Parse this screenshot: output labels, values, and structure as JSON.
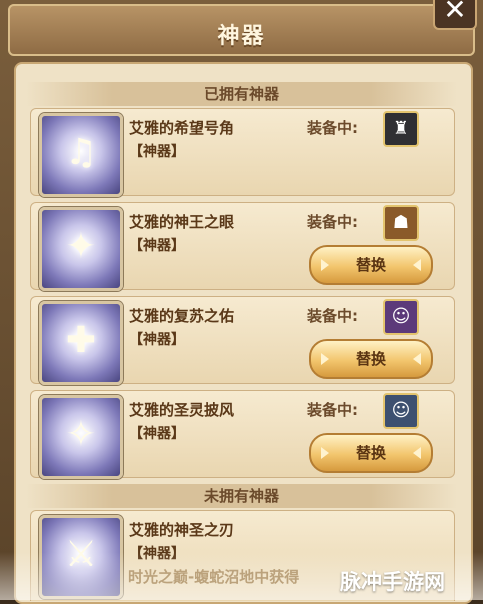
{
  "window": {
    "title": "神器",
    "close_label": "✕"
  },
  "sections": {
    "owned": "已拥有神器",
    "unowned": "未拥有神器"
  },
  "owned_items": [
    {
      "name": "艾雅的希望号角",
      "tag": "【神器】",
      "equip_label": "装备中:",
      "icon": "horn-icon",
      "avatar": "hero-armored-knight-avatar",
      "swap_label": ""
    },
    {
      "name": "艾雅的神王之眼",
      "tag": "【神器】",
      "equip_label": "装备中:",
      "icon": "eye-icon",
      "avatar": "hero-warrior-avatar",
      "swap_label": "替换"
    },
    {
      "name": "艾雅的复苏之佑",
      "tag": "【神器】",
      "equip_label": "装备中:",
      "icon": "winged-cross-icon",
      "avatar": "hero-red-haired-girl-avatar",
      "swap_label": "替换"
    },
    {
      "name": "艾雅的圣灵披风",
      "tag": "【神器】",
      "equip_label": "装备中:",
      "icon": "cloak-icon",
      "avatar": "hero-blonde-girl-avatar",
      "swap_label": "替换"
    }
  ],
  "unowned_items": [
    {
      "name": "艾雅的神圣之刃",
      "tag": "【神器】",
      "icon": "blade-icon",
      "source": "时光之巅-蝮蛇沼地中获得"
    }
  ],
  "watermark": "脉冲手游网",
  "colors": {
    "accent": "#f2c56d",
    "panel": "#efe2c6",
    "text": "#5a3818"
  }
}
